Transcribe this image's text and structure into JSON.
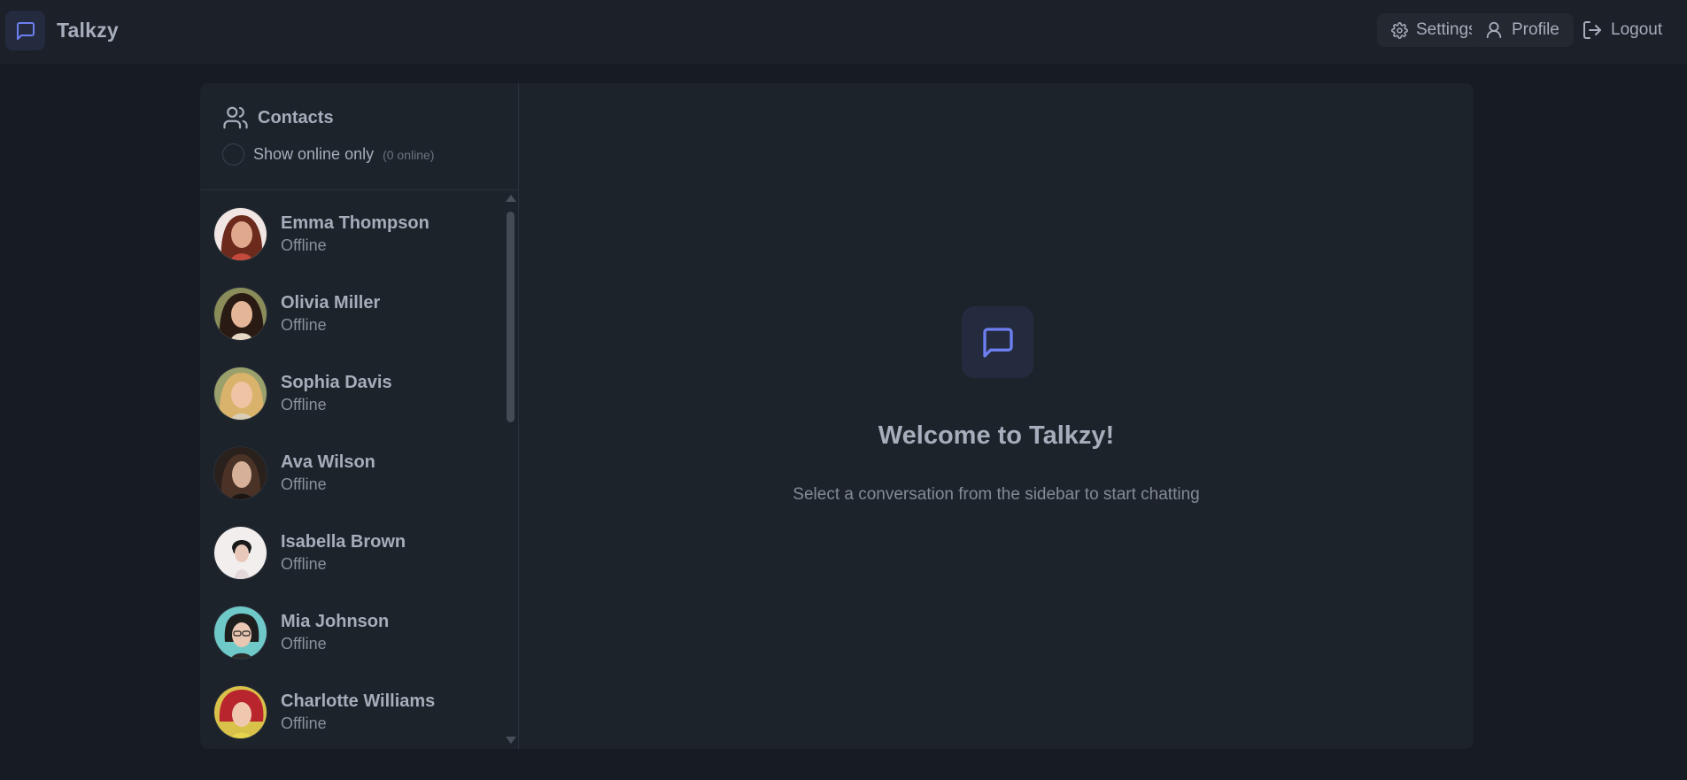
{
  "app": {
    "name": "Talkzy",
    "accent_color": "#6d7ff0",
    "logo_icon": "message-square-icon"
  },
  "nav": {
    "settings_label": "Settings",
    "profile_label": "Profile",
    "logout_label": "Logout"
  },
  "sidebar": {
    "title": "Contacts",
    "filter_label": "Show online only",
    "online_count": "(0 online)",
    "filter_checked": false,
    "contacts": [
      {
        "name": "Emma Thompson",
        "status": "Offline"
      },
      {
        "name": "Olivia Miller",
        "status": "Offline"
      },
      {
        "name": "Sophia Davis",
        "status": "Offline"
      },
      {
        "name": "Ava Wilson",
        "status": "Offline"
      },
      {
        "name": "Isabella Brown",
        "status": "Offline"
      },
      {
        "name": "Mia Johnson",
        "status": "Offline"
      },
      {
        "name": "Charlotte Williams",
        "status": "Offline"
      }
    ]
  },
  "welcome": {
    "title": "Welcome to Talkzy!",
    "subtitle": "Select a conversation from the sidebar to start chatting"
  }
}
